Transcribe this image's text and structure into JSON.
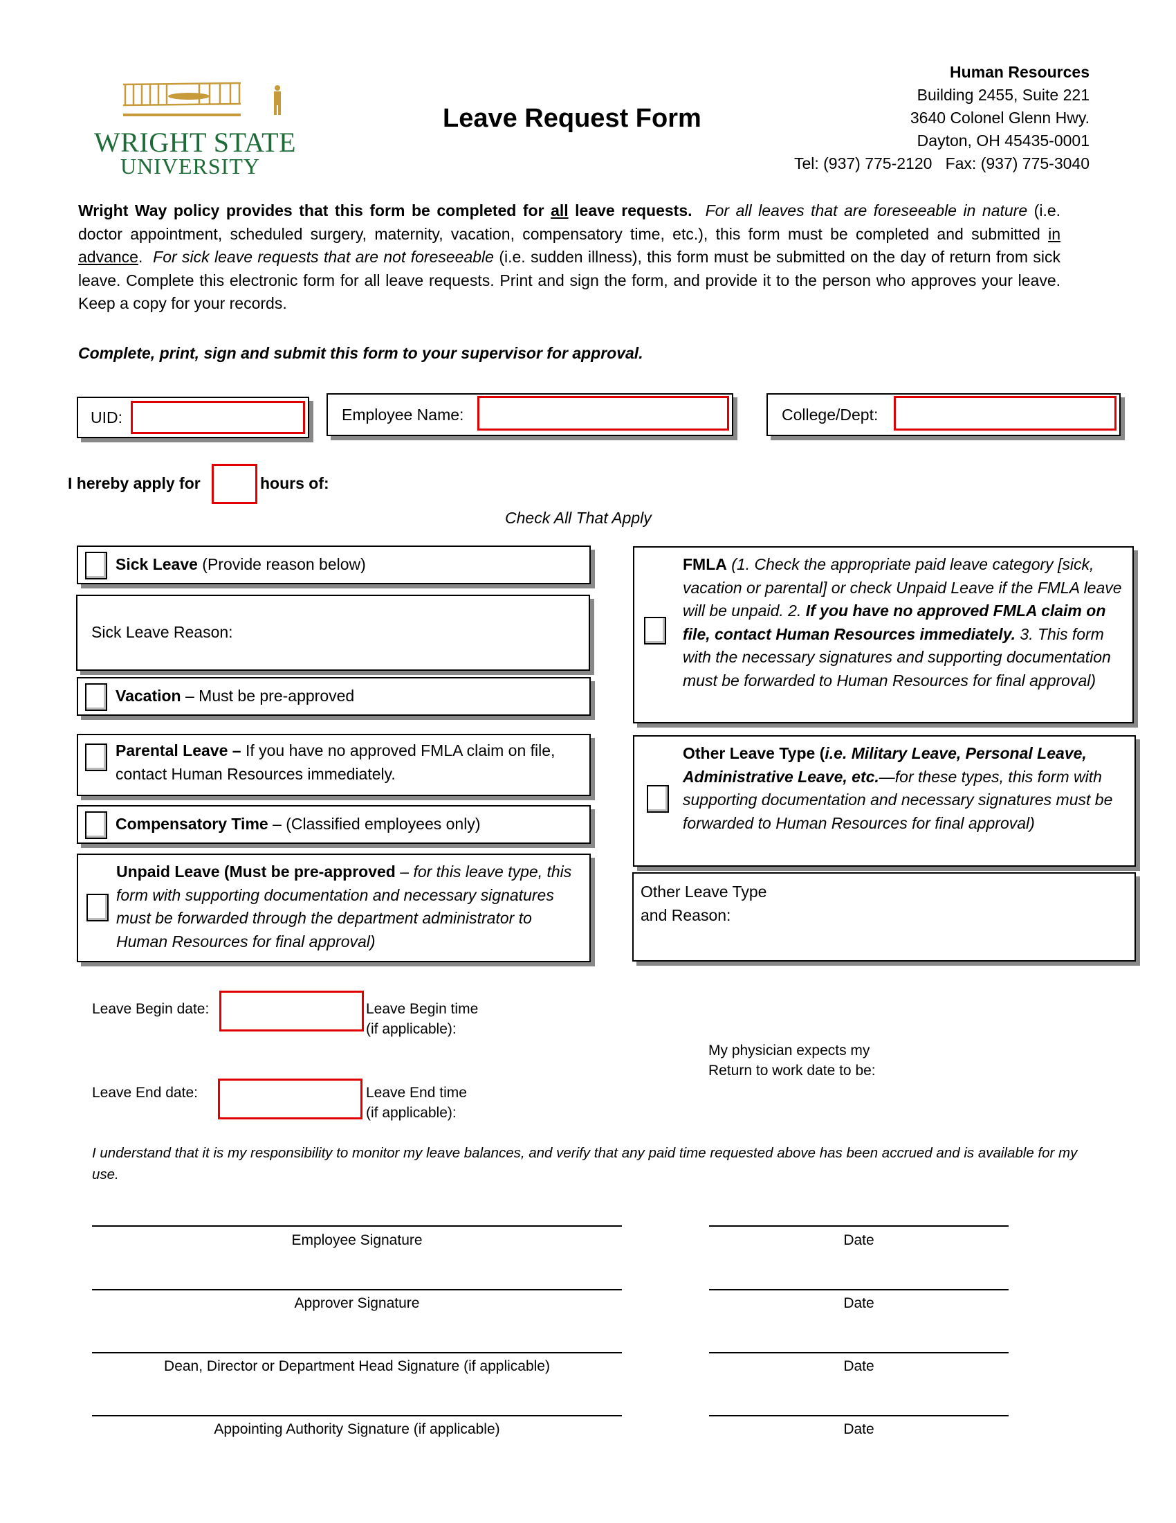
{
  "header": {
    "logo": {
      "line1": "WRIGHT STATE",
      "line2": "UNIVERSITY",
      "emblem_icon": "wright-flyer-airplane-icon",
      "colors": {
        "green": "#1e6b37",
        "gold": "#c79a3a"
      }
    },
    "title": "Leave Request Form",
    "hr": {
      "name": "Human Resources",
      "address_line1": "Building 2455, Suite 221",
      "address_line2": "3640 Colonel Glenn Hwy.",
      "address_line3": "Dayton, OH 45435-0001",
      "phone_fax": "Tel: (937) 775-2120   Fax: (937) 775-3040"
    }
  },
  "intro": {
    "p1_bold_a": "Wright Way policy provides that this form be completed for ",
    "p1_bold_underlined": "all",
    "p1_bold_b": " leave requests.",
    "p1_italic": "For all leaves that are foreseeable in nature",
    "p1_normal_a": "(i.e. doctor appointment, scheduled surgery, maternity, vacation, compensatory time, etc.), this form must be completed and submitted ",
    "p1_underlined": "in advance",
    "p1_normal_b": ".",
    "p1_italic2": "For sick leave requests that are not foreseeable",
    "p1_normal_c": " (i.e. sudden illness), this form must be submitted on the day of return from sick leave.  Complete this electronic form for all leave requests.  Print and sign the form, and provide it to the person who approves your leave.  Keep a copy for your records.",
    "instruction": "Complete, print, sign and submit this form to your supervisor for approval."
  },
  "fields": {
    "uid": {
      "label": "UID:",
      "value": ""
    },
    "employee_name": {
      "label": "Employee Name:",
      "value": ""
    },
    "college_dept": {
      "label": "College/Dept:",
      "value": ""
    },
    "hours": {
      "prefix": "I hereby apply for",
      "suffix": "hours of:",
      "value": ""
    },
    "accent_color": "#e00000"
  },
  "check_all": "Check All That Apply",
  "leave_types": {
    "sick": {
      "bold": "Sick Leave",
      "normal": " (Provide reason below)",
      "checked": false
    },
    "sick_reason": {
      "label": "Sick Leave Reason:",
      "value": ""
    },
    "vacation": {
      "bold": "Vacation",
      "normal": " – Must be pre-approved",
      "checked": false
    },
    "parental": {
      "bold": "Parental Leave –",
      "normal": " If you have no approved FMLA claim on file, contact Human Resources immediately.",
      "checked": false
    },
    "compensatory": {
      "bold": "Compensatory Time",
      "normal": " – (Classified employees only)",
      "checked": false
    },
    "unpaid": {
      "bold": "Unpaid Leave (Must be pre-approved",
      "normal": " – ",
      "italic": "for this leave type, this form with supporting documentation and necessary signatures must be forwarded through the department administrator to Human Resources for final approval)",
      "checked": false
    },
    "fmla": {
      "bold": "FMLA",
      "italic_a": " (1. Check the appropriate paid leave category [sick, vacation or parental] or check Unpaid Leave if the FMLA leave will be unpaid.  2. ",
      "bold_italic": "If you have no approved FMLA claim on file, contact Human Resources immediately.",
      "italic_b": "  3. This form with the necessary signatures and supporting documentation must be forwarded to Human Resources for final approval)",
      "checked": false
    },
    "other": {
      "bold": "Other Leave Type (",
      "bold_italic": "i.e. Military Leave, Personal Leave, Administrative Leave, etc.",
      "italic": "—for these types, this form with supporting documentation and necessary signatures must be forwarded to Human Resources for final approval)",
      "checked": false
    },
    "other_reason": {
      "label_line1": "Other Leave Type",
      "label_line2": "and Reason:",
      "value": ""
    }
  },
  "dates": {
    "begin_date": {
      "label": "Leave Begin date:",
      "value": ""
    },
    "begin_time": {
      "label_line1": "Leave Begin time",
      "label_line2": "(if applicable):",
      "value": ""
    },
    "end_date": {
      "label": "Leave End date:",
      "value": ""
    },
    "end_time": {
      "label_line1": "Leave End time",
      "label_line2": "(if applicable):",
      "value": ""
    },
    "return": {
      "label_line1": "My physician expects my",
      "label_line2": "Return to work date to be:",
      "value": ""
    }
  },
  "acknowledgement": "I understand that it is my responsibility to monitor my leave balances, and verify that any paid time requested above has been accrued and is available for my use.",
  "signatures": [
    {
      "label": "Employee Signature",
      "date_label": "Date"
    },
    {
      "label": "Approver Signature",
      "date_label": "Date"
    },
    {
      "label": "Dean, Director or Department Head Signature (if applicable)",
      "date_label": "Date"
    },
    {
      "label": "Appointing Authority Signature (if applicable)",
      "date_label": "Date"
    }
  ]
}
